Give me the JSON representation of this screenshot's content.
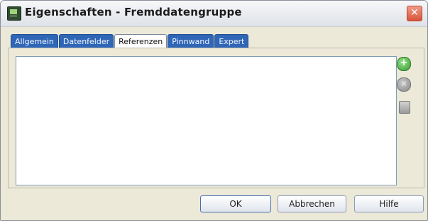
{
  "window": {
    "title": "Eigenschaften - Fremddatengruppe",
    "close_glyph": "✕"
  },
  "tabs": [
    {
      "label": "Allgemein",
      "active": false
    },
    {
      "label": "Datenfelder",
      "active": false
    },
    {
      "label": "Referenzen",
      "active": true
    },
    {
      "label": "Pinnwand",
      "active": false
    },
    {
      "label": "Expert",
      "active": false
    }
  ],
  "side_buttons": {
    "add_icon": "plus-circle-icon",
    "remove_icon": "remove-circle-icon",
    "properties_icon": "document-icon",
    "add_glyph": "+",
    "remove_glyph": "×"
  },
  "footer": {
    "ok_label": "OK",
    "cancel_label": "Abbrechen",
    "help_label": "Hilfe"
  },
  "colors": {
    "tab_active_bg": "#ffffff",
    "tab_inactive_bg": "#2f66b6",
    "close_button": "#d8533a"
  }
}
